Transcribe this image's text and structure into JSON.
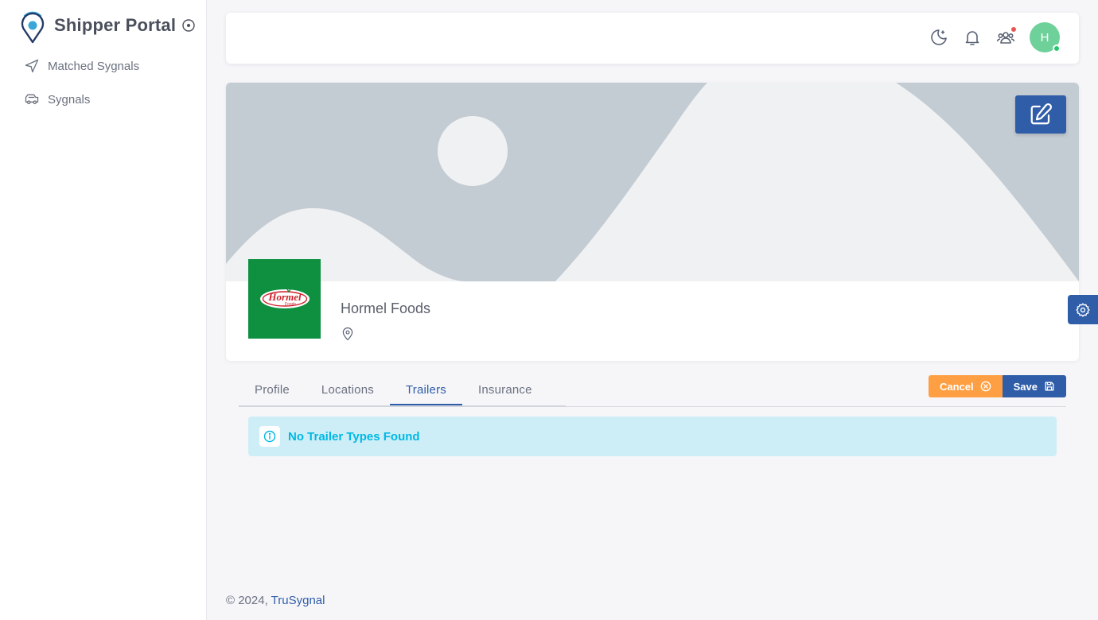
{
  "app": {
    "title": "Shipper Portal"
  },
  "sidebar": {
    "items": [
      {
        "label": "Matched Sygnals",
        "icon": "send-icon"
      },
      {
        "label": "Sygnals",
        "icon": "truck-icon"
      }
    ]
  },
  "topbar": {
    "icons": [
      "moon-icon",
      "bell-icon",
      "users-icon"
    ],
    "avatar_initial": "H",
    "notification_color": "#ea5455",
    "status_color": "#28c76f"
  },
  "profile": {
    "company_name": "Hormel Foods",
    "logo_text": "Hormel",
    "logo_subtext": "Foods",
    "logo_bg": "#0e9040"
  },
  "tabs": [
    {
      "label": "Profile",
      "active": false
    },
    {
      "label": "Locations",
      "active": false
    },
    {
      "label": "Trailers",
      "active": true
    },
    {
      "label": "Insurance",
      "active": false
    }
  ],
  "actions": {
    "cancel_label": "Cancel",
    "save_label": "Save"
  },
  "alert": {
    "message": "No Trailer Types Found"
  },
  "footer": {
    "copyright": "© 2024, ",
    "brand": "TruSygnal"
  },
  "colors": {
    "primary": "#2f5da8",
    "warning": "#ff9f43",
    "info": "#00b8e6"
  }
}
